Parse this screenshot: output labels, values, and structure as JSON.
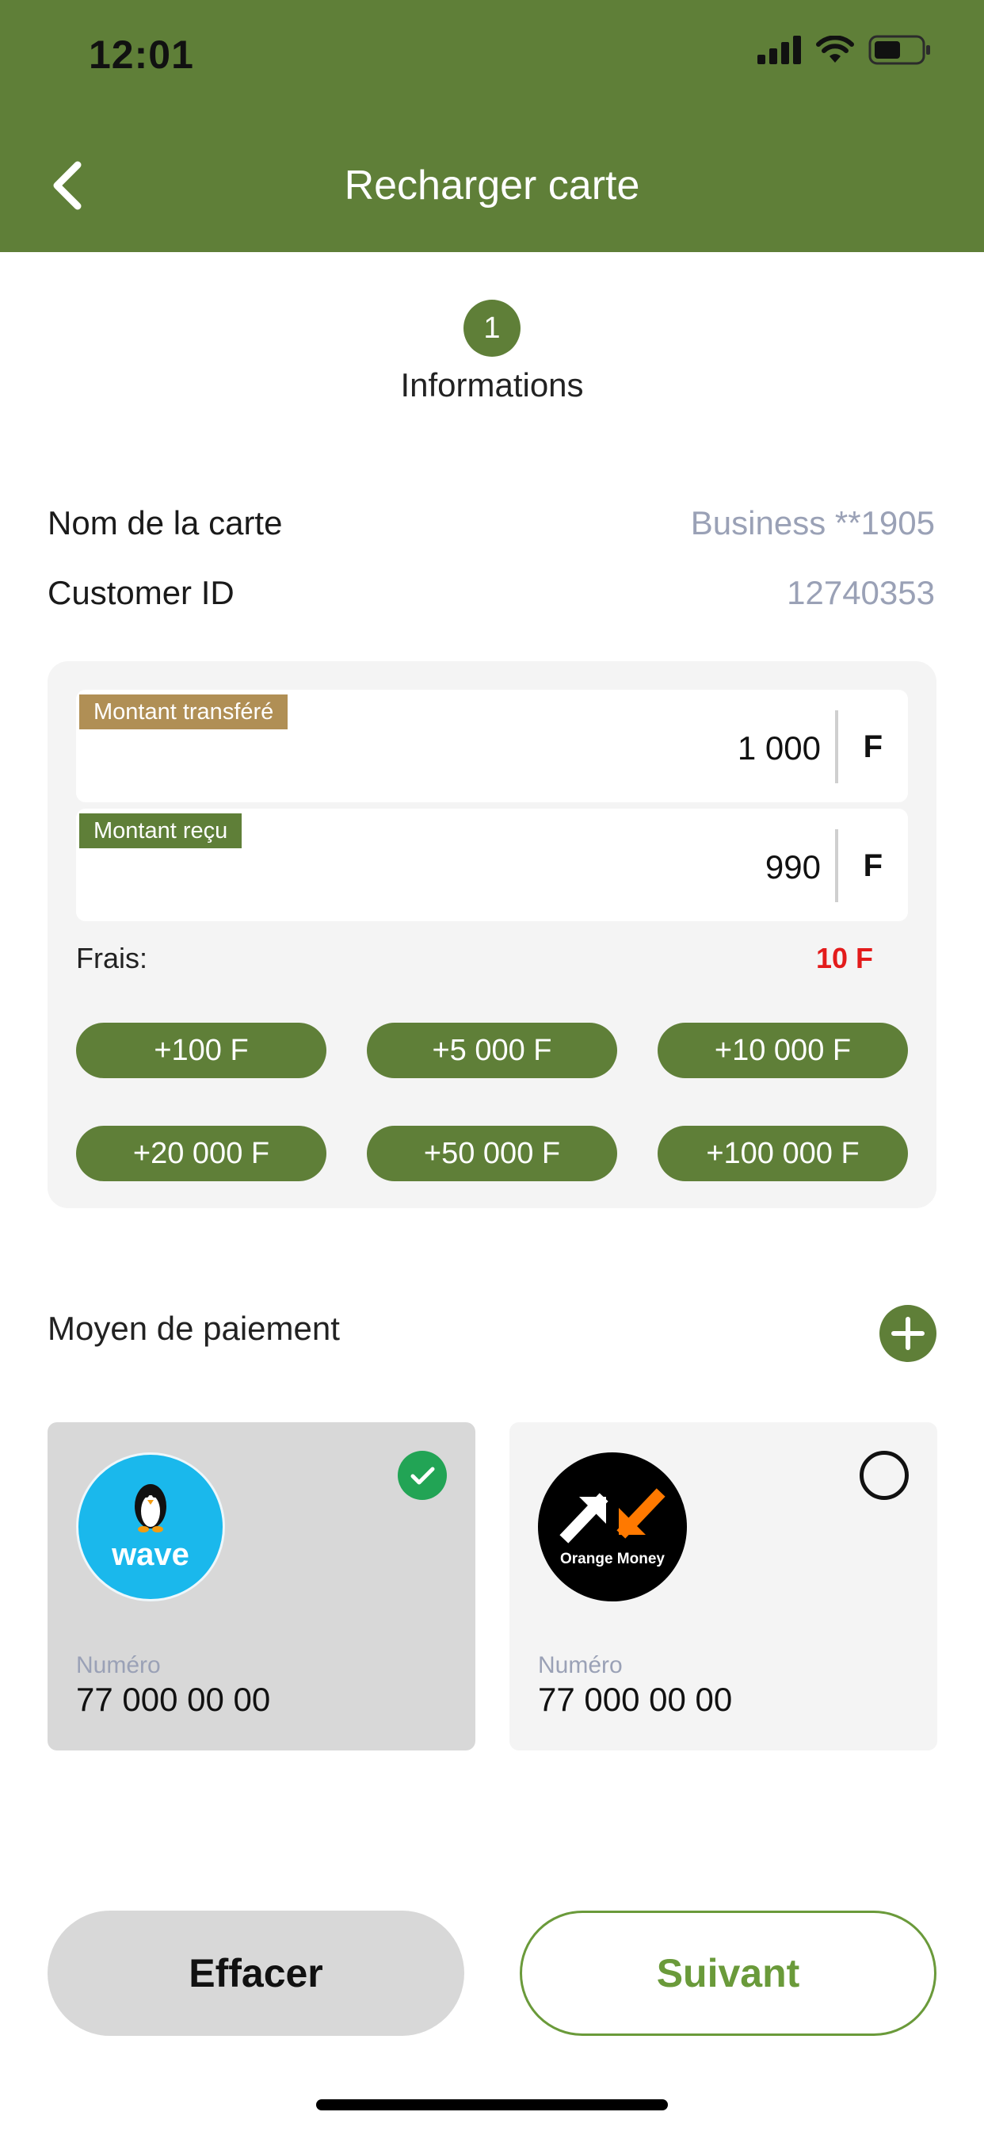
{
  "status_bar": {
    "time": "12:01"
  },
  "header": {
    "title": "Recharger carte"
  },
  "stepper": {
    "number": "1",
    "label": "Informations"
  },
  "info": {
    "card_name_label": "Nom de la carte",
    "card_name_value": "Business **1905",
    "customer_id_label": "Customer ID",
    "customer_id_value": "12740353"
  },
  "amounts": {
    "transferred": {
      "label": "Montant transféré",
      "value": "1 000",
      "unit": "F"
    },
    "received": {
      "label": "Montant reçu",
      "value": "990",
      "unit": "F"
    },
    "fees_label": "Frais:",
    "fees_value": "10 F"
  },
  "quick_amounts": [
    "+100 F",
    "+5 000 F",
    "+10 000 F",
    "+20 000 F",
    "+50 000 F",
    "+100 000 F"
  ],
  "payment": {
    "label": "Moyen de paiement",
    "methods": [
      {
        "brand": "wave",
        "number_label": "Numéro",
        "number": "77 000 00 00",
        "selected": true
      },
      {
        "brand": "Orange Money",
        "number_label": "Numéro",
        "number": "77 000 00 00",
        "selected": false
      }
    ]
  },
  "actions": {
    "clear": "Effacer",
    "next": "Suivant"
  },
  "colors": {
    "primary": "#5f7f38",
    "transferred_tag": "#b08f55",
    "fees": "#e31b1b",
    "selected_check": "#22a455",
    "wave_blue": "#1ab8ec",
    "orange": "#ff7900"
  }
}
